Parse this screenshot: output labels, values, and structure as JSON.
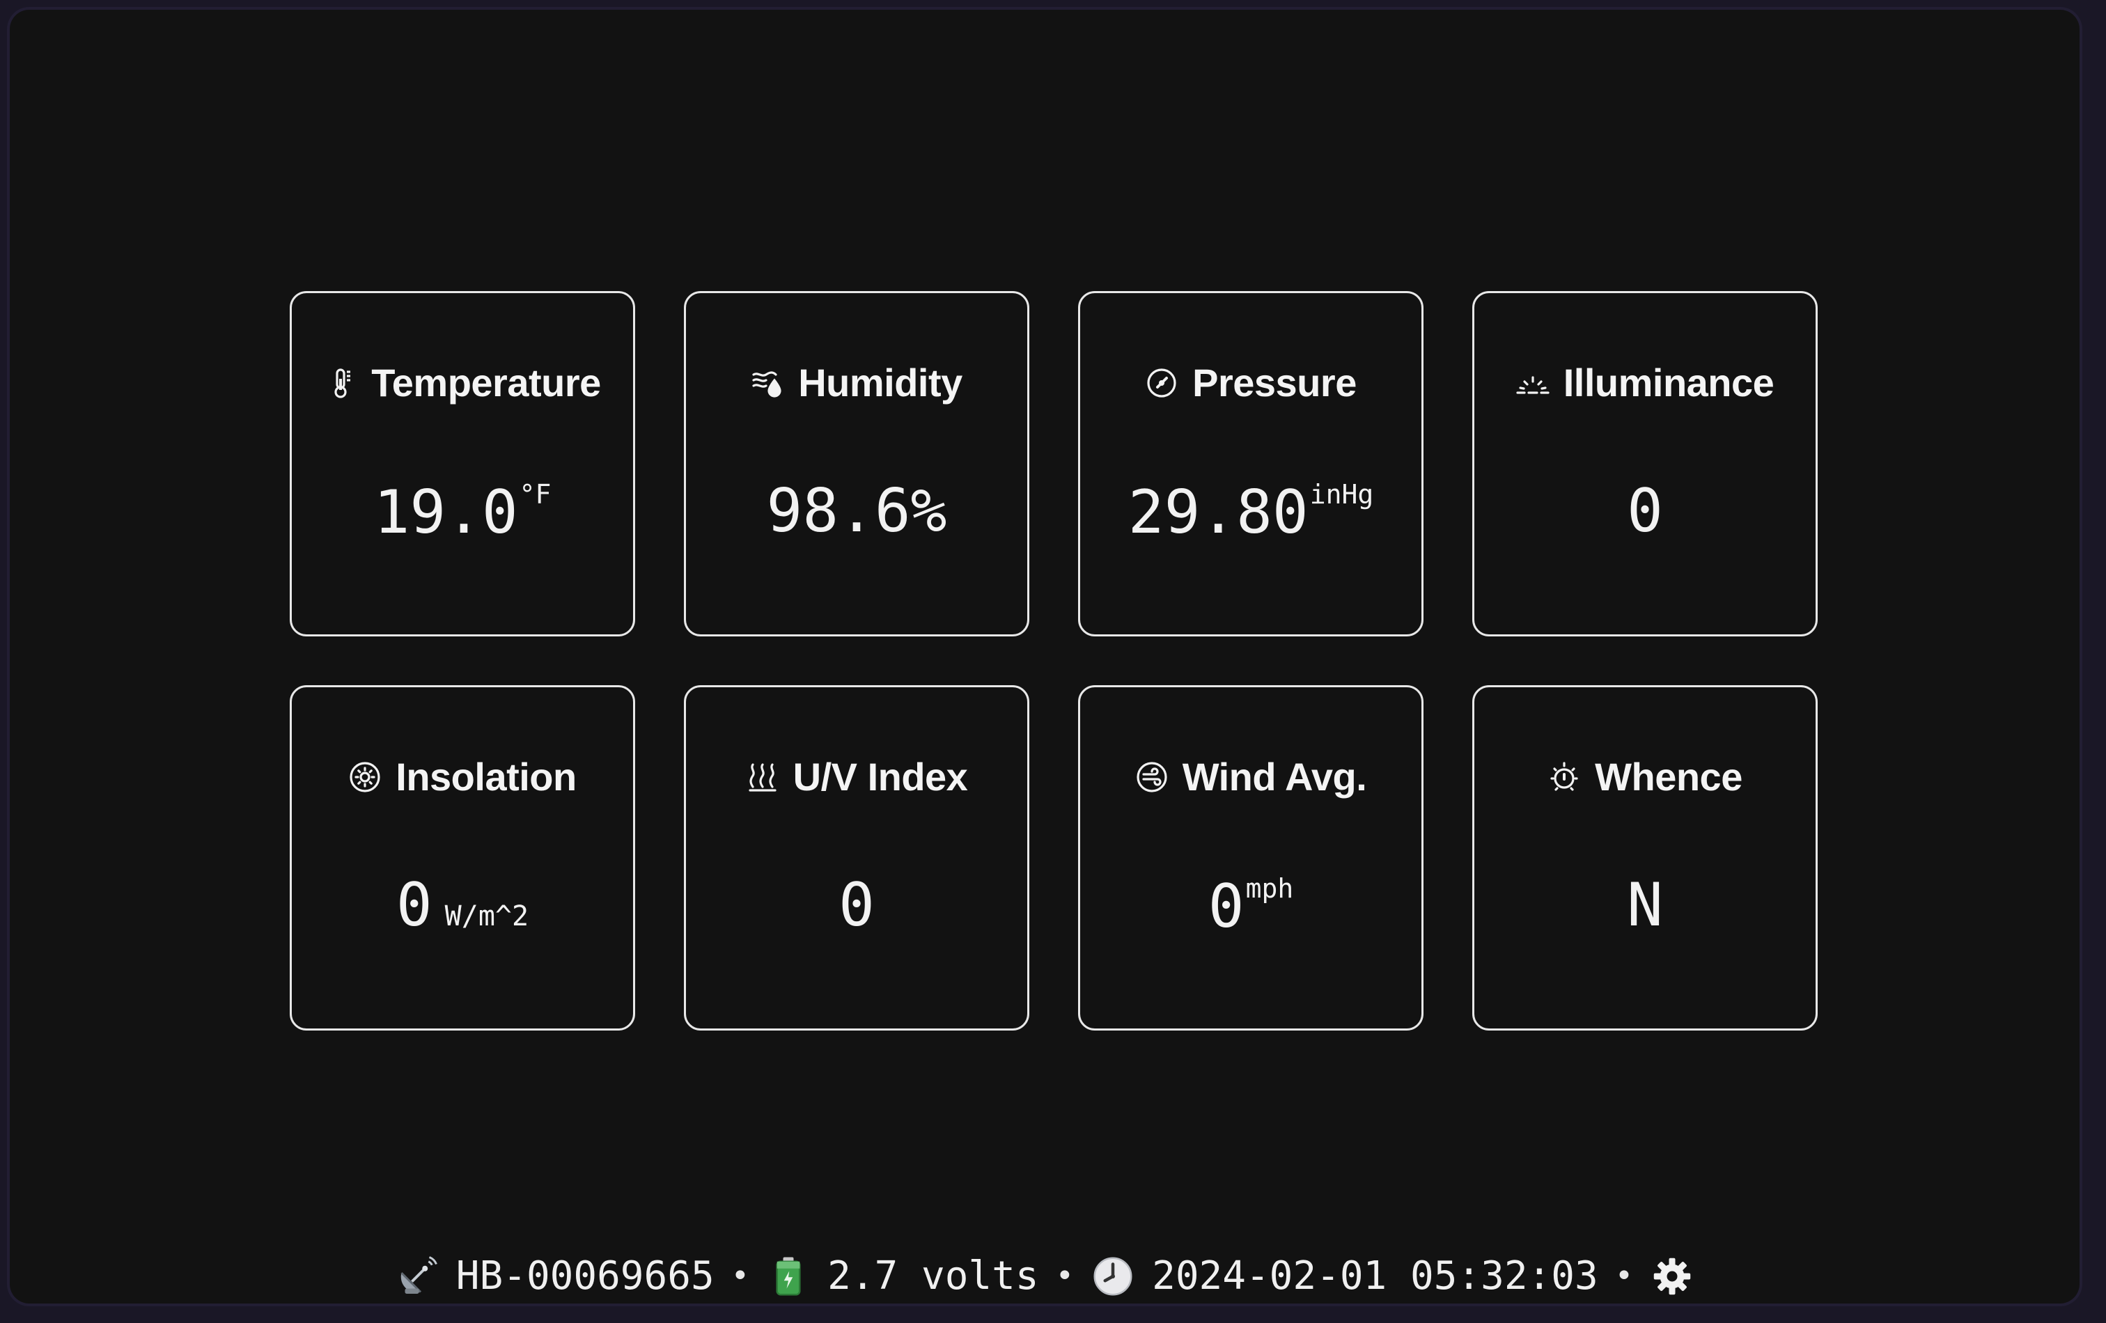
{
  "cards": [
    {
      "title": "Temperature",
      "icon": "thermometer-icon",
      "value": "19.0",
      "unit": "°F"
    },
    {
      "title": "Humidity",
      "icon": "humidity-icon",
      "value": "98.6%",
      "unit": ""
    },
    {
      "title": "Pressure",
      "icon": "gauge-icon",
      "value": "29.80",
      "unit": "inHg"
    },
    {
      "title": "Illuminance",
      "icon": "sunrise-icon",
      "value": "0",
      "unit": ""
    },
    {
      "title": "Insolation",
      "icon": "sun-icon",
      "value": "0",
      "unit": "W/m^2"
    },
    {
      "title": "U/V Index",
      "icon": "heat-waves-icon",
      "value": "0",
      "unit": ""
    },
    {
      "title": "Wind Avg.",
      "icon": "wind-icon",
      "value": "0",
      "unit": "mph"
    },
    {
      "title": "Whence",
      "icon": "compass-timer-icon",
      "value": "N",
      "unit": ""
    }
  ],
  "status": {
    "device_id": "HB-00069665",
    "voltage": "2.7 volts",
    "timestamp": "2024-02-01 05:32:03",
    "separator": "•",
    "icons": [
      "satellite-antenna-icon",
      "battery-icon",
      "clock-icon",
      "gear-icon"
    ]
  },
  "colors": {
    "background": "#121212",
    "card_border": "#e8e8e8",
    "text": "#f2f2f2"
  }
}
